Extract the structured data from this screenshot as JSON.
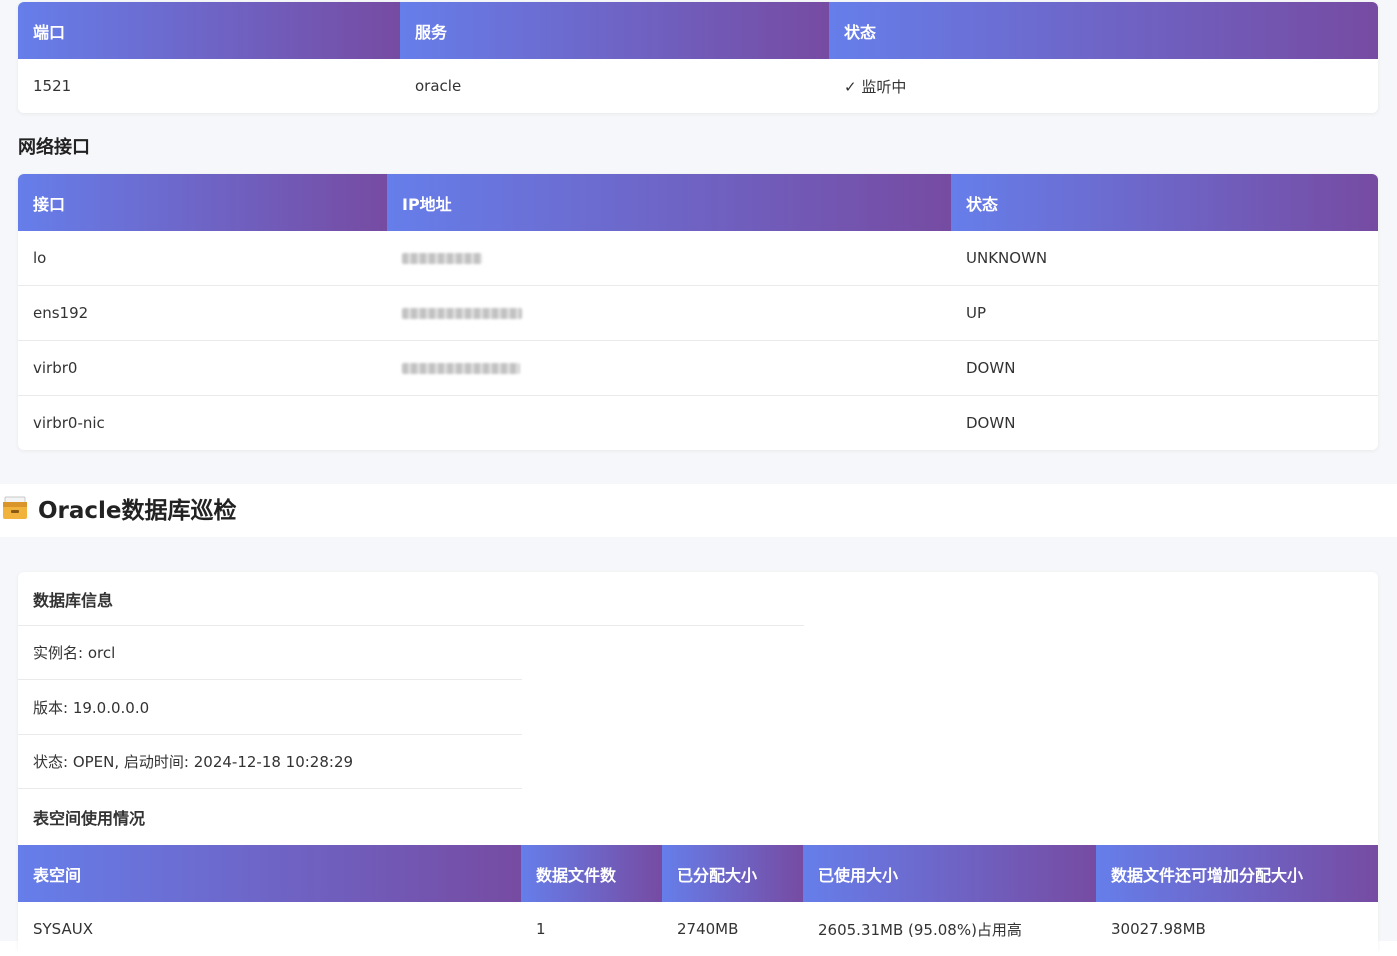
{
  "ports_table": {
    "headers": [
      "端口",
      "服务",
      "状态"
    ],
    "rows": [
      [
        "1521",
        "oracle",
        "✓ 监听中"
      ]
    ]
  },
  "network": {
    "title": "网络接口",
    "headers": [
      "接口",
      "IP地址",
      "状态"
    ],
    "rows": [
      {
        "iface": "lo",
        "ip_redacted": true,
        "status": "UNKNOWN"
      },
      {
        "iface": "ens192",
        "ip_redacted": true,
        "status": "UP"
      },
      {
        "iface": "virbr0",
        "ip_redacted": true,
        "status": "DOWN"
      },
      {
        "iface": "virbr0-nic",
        "ip_redacted": false,
        "status": "DOWN"
      }
    ]
  },
  "oracle": {
    "title": "Oracle数据库巡检",
    "icon": "card-file-box-icon",
    "db_info_title": "数据库信息",
    "instance": "实例名: orcl",
    "version": "版本: 19.0.0.0.0",
    "status": "状态: OPEN, 启动时间: 2024-12-18 10:28:29",
    "tablespace_title": "表空间使用情况",
    "tablespace_headers": [
      "表空间",
      "数据文件数",
      "已分配大小",
      "已使用大小",
      "数据文件还可增加分配大小"
    ],
    "tablespace_rows": [
      [
        "SYSAUX",
        "1",
        "2740MB",
        "2605.31MB (95.08%)占用高",
        "30027.98MB"
      ]
    ]
  },
  "colors": {
    "header_gradient_start": "#667eea",
    "header_gradient_end": "#764ba2",
    "page_band": "#f5f7fa"
  }
}
